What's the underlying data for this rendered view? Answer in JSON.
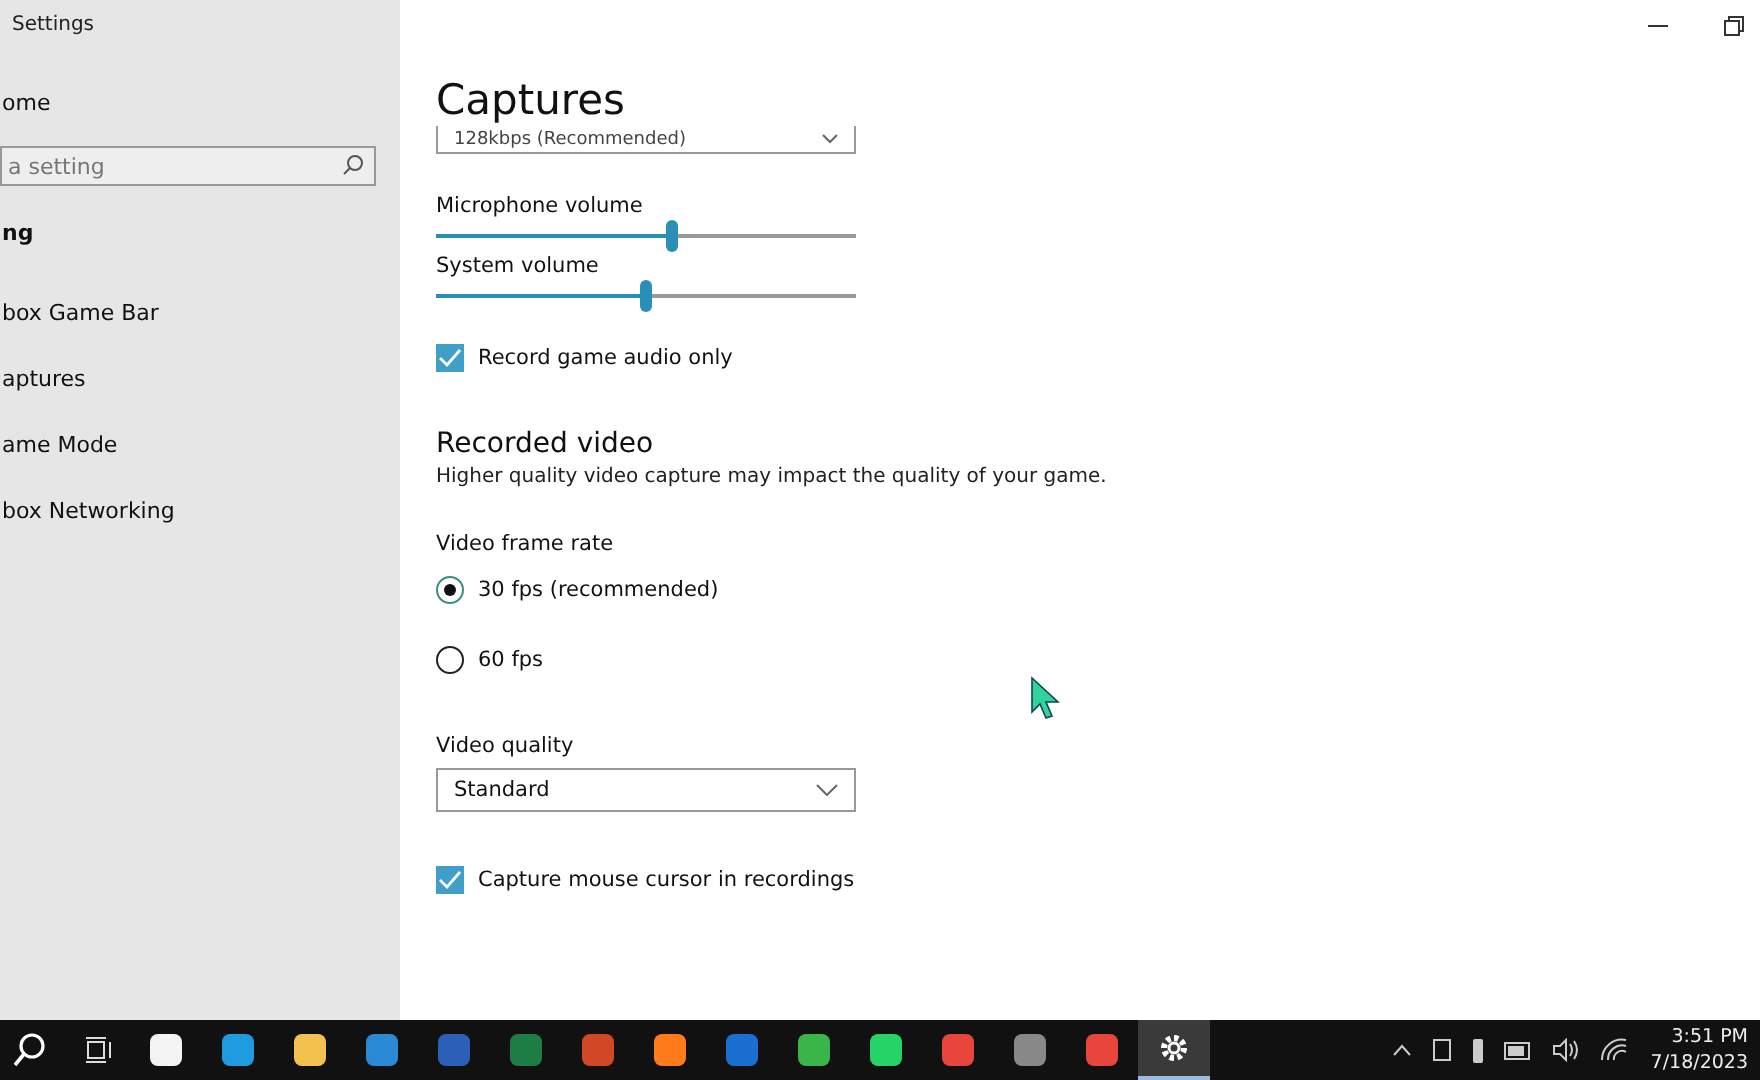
{
  "window": {
    "title": "Settings"
  },
  "sidebar": {
    "home": "ome",
    "search": {
      "placeholder": "a setting"
    },
    "section": "ng",
    "items": [
      {
        "label": "box Game Bar"
      },
      {
        "label": "aptures"
      },
      {
        "label": "ame Mode"
      },
      {
        "label": "box Networking"
      }
    ]
  },
  "page": {
    "title": "Captures",
    "audio_quality": {
      "value": "128kbps (Recommended)"
    },
    "sliders": [
      {
        "label": "Microphone volume",
        "level": 0.56
      },
      {
        "label": "System volume",
        "level": 0.5
      }
    ],
    "record_game_audio_only": {
      "label": "Record game audio only",
      "checked": true
    },
    "recorded_video": {
      "heading": "Recorded video",
      "description": "Higher quality video capture may impact the quality of your game.",
      "frame_rate_label": "Video frame rate",
      "frame_rates": [
        {
          "label": "30 fps (recommended)",
          "selected": true
        },
        {
          "label": "60 fps",
          "selected": false
        }
      ],
      "quality_label": "Video quality",
      "quality": {
        "value": "Standard"
      },
      "capture_cursor": {
        "label": "Capture mouse cursor in recordings",
        "checked": true
      }
    }
  },
  "taskbar": {
    "time": "3:51 PM",
    "date": "7/18/2023"
  }
}
